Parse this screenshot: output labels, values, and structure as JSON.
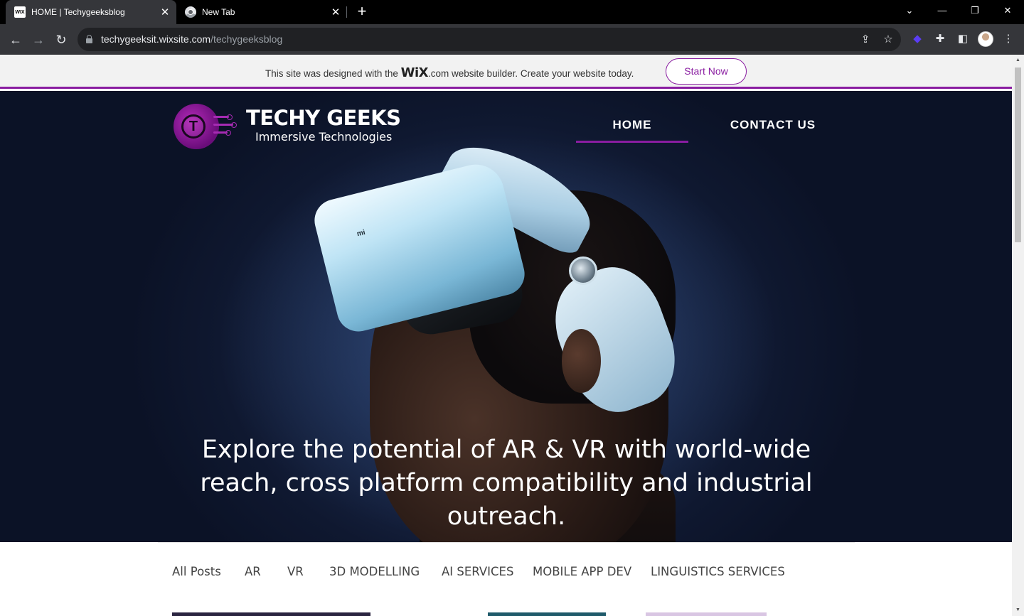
{
  "browser": {
    "tabs": [
      {
        "title": "HOME | Techygeeksblog",
        "favicon": "WIX",
        "active": true
      },
      {
        "title": "New Tab",
        "favicon": "chrome-icon",
        "active": false
      }
    ],
    "new_tab_symbol": "+",
    "window_controls": {
      "tab_search": "⌄",
      "minimize": "—",
      "restore": "❐",
      "close": "✕"
    },
    "url_host": "techygeeksit.wixsite.com",
    "url_path": "/techygeeksblog"
  },
  "wix_banner": {
    "text_before": "This site was designed with the ",
    "brand": "WiX",
    "brand_suffix": ".com",
    "text_after": " website builder. Create your website today.",
    "button_label": "Start Now",
    "accent_color": "#8a1da1"
  },
  "site": {
    "logo_letter": "T",
    "logo_title": "TECHY GEEKS",
    "logo_subtitle": "Immersive Technologies",
    "nav": [
      {
        "label": "HOME",
        "active": true
      },
      {
        "label": "CONTACT US",
        "active": false
      }
    ],
    "hero_text": "Explore the potential of AR & VR with world-wide reach, cross platform compatibility and industrial outreach.",
    "headset_brand_mark": "mi",
    "categories": [
      "All Posts",
      "AR",
      "VR",
      "3D MODELLING",
      "AI SERVICES",
      "MOBILE APP DEV",
      "LINGUISTICS SERVICES"
    ]
  }
}
